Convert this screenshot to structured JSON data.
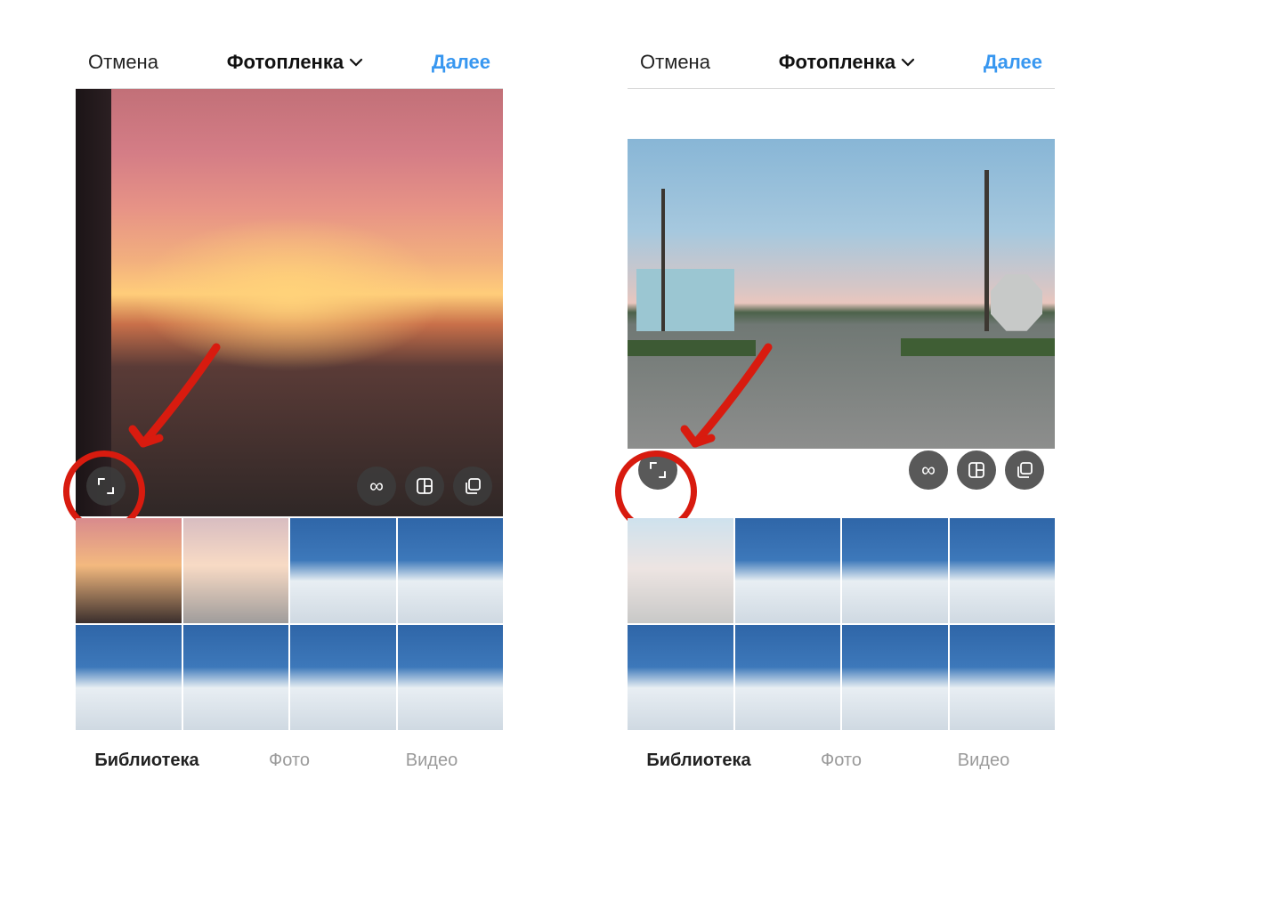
{
  "header": {
    "cancel": "Отмена",
    "title": "Фотопленка",
    "next": "Далее"
  },
  "action_buttons": {
    "expand": "expand-crop-icon",
    "infinity": "boomerang-icon",
    "collage": "layout-collage-icon",
    "stack": "multi-select-icon"
  },
  "tabs": {
    "library": "Библиотека",
    "photo": "Фото",
    "video": "Видео",
    "active": "library"
  },
  "screens": [
    {
      "id": "left",
      "preview_kind": "sunset-portrait",
      "thumbs": [
        {
          "kind": "t-sunset",
          "selected": false
        },
        {
          "kind": "t-sunset2",
          "selected": true
        },
        {
          "kind": "t-mtn",
          "selected": false
        },
        {
          "kind": "t-mtn",
          "selected": false
        },
        {
          "kind": "t-mtn",
          "selected": false
        },
        {
          "kind": "t-mtn",
          "selected": false
        },
        {
          "kind": "t-mtn",
          "selected": false
        },
        {
          "kind": "t-mtn",
          "selected": false
        }
      ]
    },
    {
      "id": "right",
      "preview_kind": "road-landscape",
      "thumbs": [
        {
          "kind": "t-road",
          "selected": true
        },
        {
          "kind": "t-mtn",
          "selected": false
        },
        {
          "kind": "t-mtn",
          "selected": false
        },
        {
          "kind": "t-mtn",
          "selected": false
        },
        {
          "kind": "t-mtn",
          "selected": false
        },
        {
          "kind": "t-mtn",
          "selected": false
        },
        {
          "kind": "t-mtn",
          "selected": false
        },
        {
          "kind": "t-mtn",
          "selected": false
        }
      ]
    }
  ],
  "annotation": {
    "target": "expand-crop-button",
    "style": "red-circle-with-arrow"
  }
}
